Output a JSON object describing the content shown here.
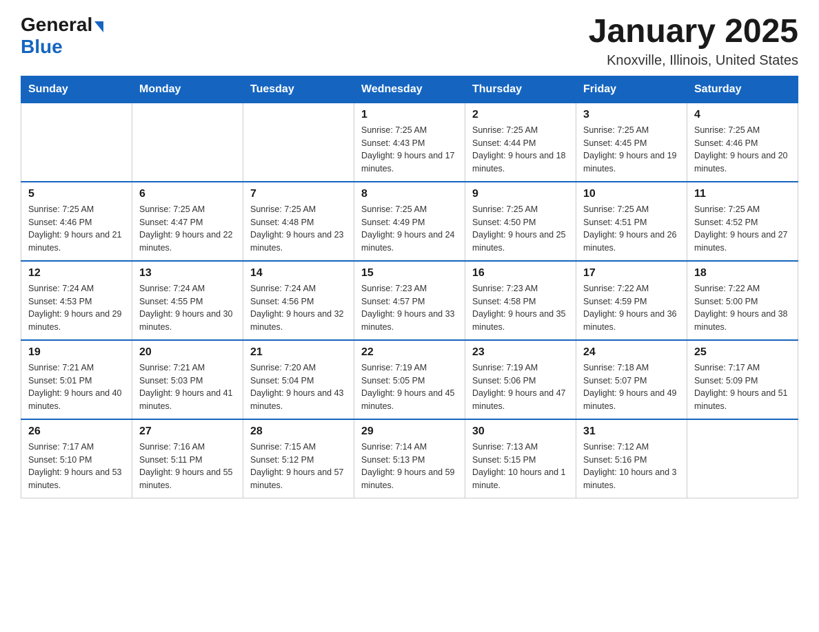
{
  "logo": {
    "general": "General",
    "blue": "Blue",
    "arrow": "▶"
  },
  "title": "January 2025",
  "location": "Knoxville, Illinois, United States",
  "days_of_week": [
    "Sunday",
    "Monday",
    "Tuesday",
    "Wednesday",
    "Thursday",
    "Friday",
    "Saturday"
  ],
  "weeks": [
    [
      {
        "day": "",
        "info": ""
      },
      {
        "day": "",
        "info": ""
      },
      {
        "day": "",
        "info": ""
      },
      {
        "day": "1",
        "info": "Sunrise: 7:25 AM\nSunset: 4:43 PM\nDaylight: 9 hours\nand 17 minutes."
      },
      {
        "day": "2",
        "info": "Sunrise: 7:25 AM\nSunset: 4:44 PM\nDaylight: 9 hours\nand 18 minutes."
      },
      {
        "day": "3",
        "info": "Sunrise: 7:25 AM\nSunset: 4:45 PM\nDaylight: 9 hours\nand 19 minutes."
      },
      {
        "day": "4",
        "info": "Sunrise: 7:25 AM\nSunset: 4:46 PM\nDaylight: 9 hours\nand 20 minutes."
      }
    ],
    [
      {
        "day": "5",
        "info": "Sunrise: 7:25 AM\nSunset: 4:46 PM\nDaylight: 9 hours\nand 21 minutes."
      },
      {
        "day": "6",
        "info": "Sunrise: 7:25 AM\nSunset: 4:47 PM\nDaylight: 9 hours\nand 22 minutes."
      },
      {
        "day": "7",
        "info": "Sunrise: 7:25 AM\nSunset: 4:48 PM\nDaylight: 9 hours\nand 23 minutes."
      },
      {
        "day": "8",
        "info": "Sunrise: 7:25 AM\nSunset: 4:49 PM\nDaylight: 9 hours\nand 24 minutes."
      },
      {
        "day": "9",
        "info": "Sunrise: 7:25 AM\nSunset: 4:50 PM\nDaylight: 9 hours\nand 25 minutes."
      },
      {
        "day": "10",
        "info": "Sunrise: 7:25 AM\nSunset: 4:51 PM\nDaylight: 9 hours\nand 26 minutes."
      },
      {
        "day": "11",
        "info": "Sunrise: 7:25 AM\nSunset: 4:52 PM\nDaylight: 9 hours\nand 27 minutes."
      }
    ],
    [
      {
        "day": "12",
        "info": "Sunrise: 7:24 AM\nSunset: 4:53 PM\nDaylight: 9 hours\nand 29 minutes."
      },
      {
        "day": "13",
        "info": "Sunrise: 7:24 AM\nSunset: 4:55 PM\nDaylight: 9 hours\nand 30 minutes."
      },
      {
        "day": "14",
        "info": "Sunrise: 7:24 AM\nSunset: 4:56 PM\nDaylight: 9 hours\nand 32 minutes."
      },
      {
        "day": "15",
        "info": "Sunrise: 7:23 AM\nSunset: 4:57 PM\nDaylight: 9 hours\nand 33 minutes."
      },
      {
        "day": "16",
        "info": "Sunrise: 7:23 AM\nSunset: 4:58 PM\nDaylight: 9 hours\nand 35 minutes."
      },
      {
        "day": "17",
        "info": "Sunrise: 7:22 AM\nSunset: 4:59 PM\nDaylight: 9 hours\nand 36 minutes."
      },
      {
        "day": "18",
        "info": "Sunrise: 7:22 AM\nSunset: 5:00 PM\nDaylight: 9 hours\nand 38 minutes."
      }
    ],
    [
      {
        "day": "19",
        "info": "Sunrise: 7:21 AM\nSunset: 5:01 PM\nDaylight: 9 hours\nand 40 minutes."
      },
      {
        "day": "20",
        "info": "Sunrise: 7:21 AM\nSunset: 5:03 PM\nDaylight: 9 hours\nand 41 minutes."
      },
      {
        "day": "21",
        "info": "Sunrise: 7:20 AM\nSunset: 5:04 PM\nDaylight: 9 hours\nand 43 minutes."
      },
      {
        "day": "22",
        "info": "Sunrise: 7:19 AM\nSunset: 5:05 PM\nDaylight: 9 hours\nand 45 minutes."
      },
      {
        "day": "23",
        "info": "Sunrise: 7:19 AM\nSunset: 5:06 PM\nDaylight: 9 hours\nand 47 minutes."
      },
      {
        "day": "24",
        "info": "Sunrise: 7:18 AM\nSunset: 5:07 PM\nDaylight: 9 hours\nand 49 minutes."
      },
      {
        "day": "25",
        "info": "Sunrise: 7:17 AM\nSunset: 5:09 PM\nDaylight: 9 hours\nand 51 minutes."
      }
    ],
    [
      {
        "day": "26",
        "info": "Sunrise: 7:17 AM\nSunset: 5:10 PM\nDaylight: 9 hours\nand 53 minutes."
      },
      {
        "day": "27",
        "info": "Sunrise: 7:16 AM\nSunset: 5:11 PM\nDaylight: 9 hours\nand 55 minutes."
      },
      {
        "day": "28",
        "info": "Sunrise: 7:15 AM\nSunset: 5:12 PM\nDaylight: 9 hours\nand 57 minutes."
      },
      {
        "day": "29",
        "info": "Sunrise: 7:14 AM\nSunset: 5:13 PM\nDaylight: 9 hours\nand 59 minutes."
      },
      {
        "day": "30",
        "info": "Sunrise: 7:13 AM\nSunset: 5:15 PM\nDaylight: 10 hours\nand 1 minute."
      },
      {
        "day": "31",
        "info": "Sunrise: 7:12 AM\nSunset: 5:16 PM\nDaylight: 10 hours\nand 3 minutes."
      },
      {
        "day": "",
        "info": ""
      }
    ]
  ]
}
